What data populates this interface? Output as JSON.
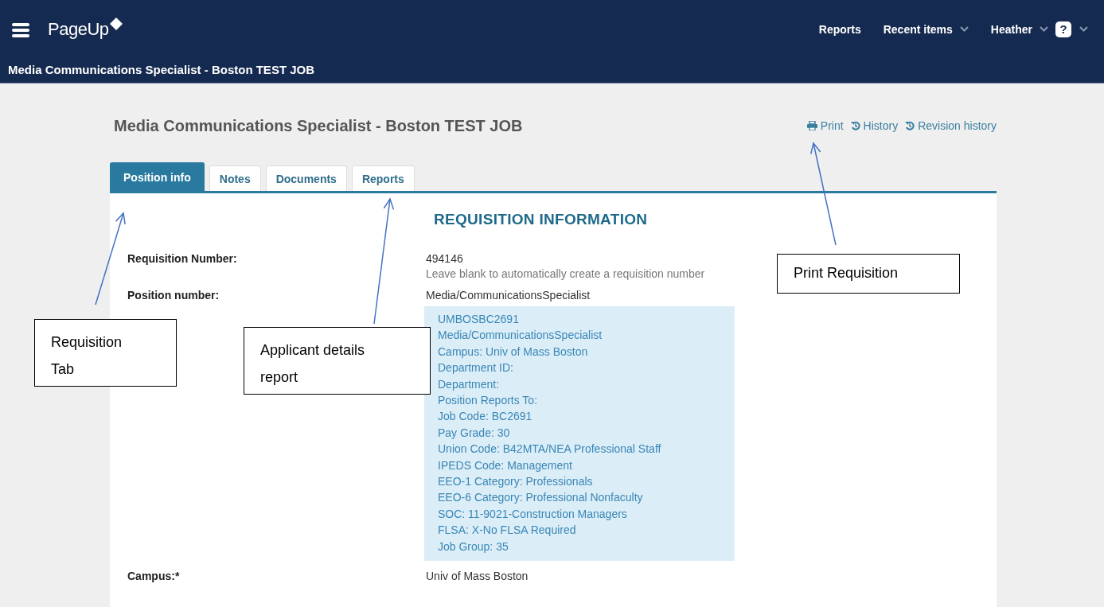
{
  "header": {
    "app_name": "PageUp",
    "nav": [
      {
        "label": "Reports",
        "dropdown": false
      },
      {
        "label": "Recent items",
        "dropdown": true
      },
      {
        "label": "Heather",
        "dropdown": true
      }
    ],
    "help": {
      "glyph": "?",
      "dropdown": true
    }
  },
  "breadcrumb_title": "Media Communications Specialist - Boston TEST JOB",
  "page": {
    "title": "Media Communications Specialist - Boston TEST JOB",
    "actions": [
      {
        "label": "Print",
        "kind": "print"
      },
      {
        "label": "History",
        "kind": "history"
      },
      {
        "label": "Revision history",
        "kind": "history"
      }
    ]
  },
  "tabs": [
    {
      "label": "Position info",
      "selected": true
    },
    {
      "label": "Notes",
      "selected": false
    },
    {
      "label": "Documents",
      "selected": false
    },
    {
      "label": "Reports",
      "selected": false
    }
  ],
  "section_heading": "REQUISITION INFORMATION",
  "fields": [
    {
      "label": "Requisition Number:",
      "value": "494146",
      "hint": "Leave blank to automatically create a requisition number"
    },
    {
      "label": "Position number:",
      "value": "Media/CommunicationsSpecialist",
      "details": [
        "UMBOSBC2691",
        "Media/CommunicationsSpecialist",
        "Campus: Univ of Mass Boston",
        "Department ID:",
        "Department:",
        "Position Reports To:",
        "Job Code: BC2691",
        "Pay Grade: 30",
        "Union Code: B42MTA/NEA Professional Staff",
        "IPEDS Code: Management",
        "EEO-1 Category: Professionals",
        "EEO-6 Category: Professional Nonfaculty",
        "SOC: 11-9021-Construction Managers",
        "FLSA: X-No FLSA Required",
        "Job Group: 35"
      ]
    },
    {
      "label": "Campus:*",
      "value": "Univ of Mass Boston"
    }
  ],
  "annotations": [
    {
      "text": "Requisition Tab"
    },
    {
      "text": "Applicant details report"
    },
    {
      "text": "Print Requisition"
    }
  ]
}
